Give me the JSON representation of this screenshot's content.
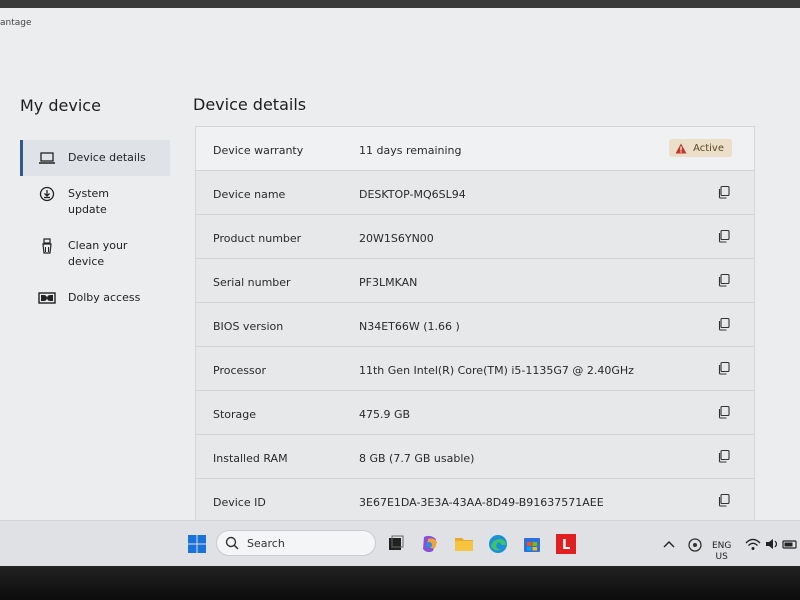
{
  "window": {
    "title": "antage"
  },
  "sidebar": {
    "title": "My device",
    "items": [
      {
        "label": "Device details",
        "icon": "laptop-icon",
        "active": true
      },
      {
        "label": "System update",
        "icon": "download-icon",
        "active": false
      },
      {
        "label": "Clean your device",
        "icon": "broom-icon",
        "active": false
      },
      {
        "label": "Dolby access",
        "icon": "dolby-icon",
        "active": false
      }
    ]
  },
  "main": {
    "title": "Device details",
    "rows": [
      {
        "key": "Device warranty",
        "value": "11 days remaining",
        "badge": "Active"
      },
      {
        "key": "Device name",
        "value": "DESKTOP-MQ6SL94"
      },
      {
        "key": "Product number",
        "value": "20W1S6YN00"
      },
      {
        "key": "Serial number",
        "value": "PF3LMKAN"
      },
      {
        "key": "BIOS version",
        "value": "N34ET66W (1.66 )"
      },
      {
        "key": "Processor",
        "value": "11th Gen Intel(R) Core(TM) i5-1135G7 @ 2.40GHz"
      },
      {
        "key": "Storage",
        "value": "475.9 GB"
      },
      {
        "key": "Installed RAM",
        "value": "8 GB (7.7 GB usable)"
      },
      {
        "key": "Device ID",
        "value": "3E67E1DA-3E3A-43AA-8D49-B91637571AEE"
      }
    ]
  },
  "taskbar": {
    "search_placeholder": "Search",
    "lang_top": "ENG",
    "lang_bottom": "US",
    "app_letter": "L"
  },
  "colors": {
    "accent": "#2f5a8a",
    "badge_bg": "#ecdfc9",
    "warning": "#c0392b"
  }
}
